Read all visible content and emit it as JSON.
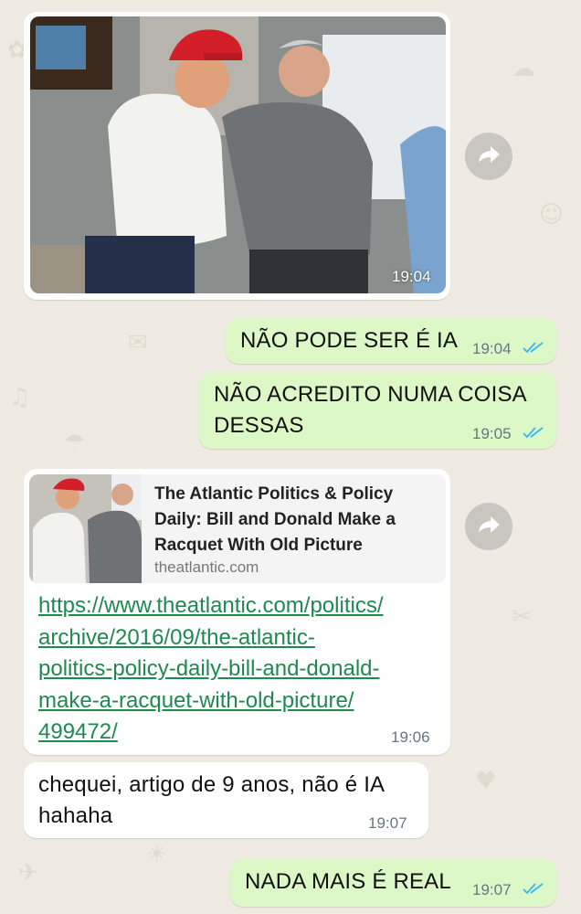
{
  "chat": {
    "photo_message": {
      "time": "19:04"
    },
    "out_msg_1": {
      "text": "NÃO PODE SER É IA",
      "time": "19:04"
    },
    "out_msg_2": {
      "line1": "NÃO ACREDITO NUMA COISA",
      "line2": "DESSAS",
      "time": "19:05"
    },
    "link_message": {
      "preview_title": "The Atlantic  Politics & Policy\nDaily: Bill and Donald Make a\nRacquet With Old Picture",
      "preview_domain": "theatlantic.com",
      "url": "https://www.theatlantic.com/politics/\narchive/2016/09/the-atlantic-\npolitics-policy-daily-bill-and-donald-\nmake-a-racquet-with-old-picture/\n499472/",
      "time": "19:06"
    },
    "in_msg_1": {
      "line1": "chequei, artigo de 9 anos, não é IA",
      "line2": "hahaha",
      "time": "19:07"
    },
    "out_msg_3": {
      "text": "NADA MAIS É REAL",
      "time": "19:07"
    }
  },
  "colors": {
    "wallpaper": "#efeae2",
    "incoming_bubble": "#ffffff",
    "outgoing_bubble": "#dcf8c6",
    "read_ticks": "#34b7f1",
    "link": "#1d8a4e"
  },
  "icons": [
    "forward-icon",
    "double-check-icon"
  ]
}
